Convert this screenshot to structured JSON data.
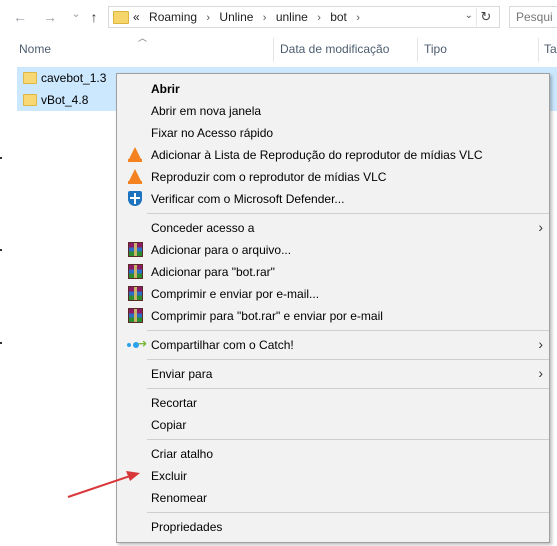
{
  "nav": {
    "back_icon": "←",
    "forward_icon": "→",
    "recent_icon": "⌄",
    "up_icon": "↑"
  },
  "address": {
    "overflow": "«",
    "crumbs": [
      "Roaming",
      "Unline",
      "unline",
      "bot"
    ],
    "separator": "›",
    "dropdown_icon": "⌄",
    "refresh_icon": "↻"
  },
  "search": {
    "placeholder": "Pesqui"
  },
  "columns": {
    "name": "Nome",
    "modified": "Data de modificação",
    "type": "Tipo",
    "size": "Tar"
  },
  "files": [
    {
      "name": "cavebot_1.3"
    },
    {
      "name": "vBot_4.8"
    }
  ],
  "menu": {
    "open": "Abrir",
    "open_new_window": "Abrir em nova janela",
    "pin_quick_access": "Fixar no Acesso rápido",
    "vlc_add_playlist": "Adicionar à Lista de Reprodução do reprodutor de mídias VLC",
    "vlc_play": "Reproduzir com o reprodutor de mídias VLC",
    "defender_scan": "Verificar com o Microsoft Defender...",
    "give_access": "Conceder acesso a",
    "rar_add_archive": "Adicionar para o arquivo...",
    "rar_add_bot": "Adicionar para \"bot.rar\"",
    "rar_compress_email": "Comprimir e enviar por e-mail...",
    "rar_compress_bot_email": "Comprimir para \"bot.rar\" e enviar por e-mail",
    "share_catch": "Compartilhar com o Catch!",
    "send_to": "Enviar para",
    "cut": "Recortar",
    "copy": "Copiar",
    "create_shortcut": "Criar atalho",
    "delete": "Excluir",
    "rename": "Renomear",
    "properties": "Propriedades",
    "submenu_arrow": "›"
  },
  "colors": {
    "selection": "#cce8ff",
    "menu_bg": "#f2f2f2",
    "pointer_arrow": "#d9383a"
  }
}
